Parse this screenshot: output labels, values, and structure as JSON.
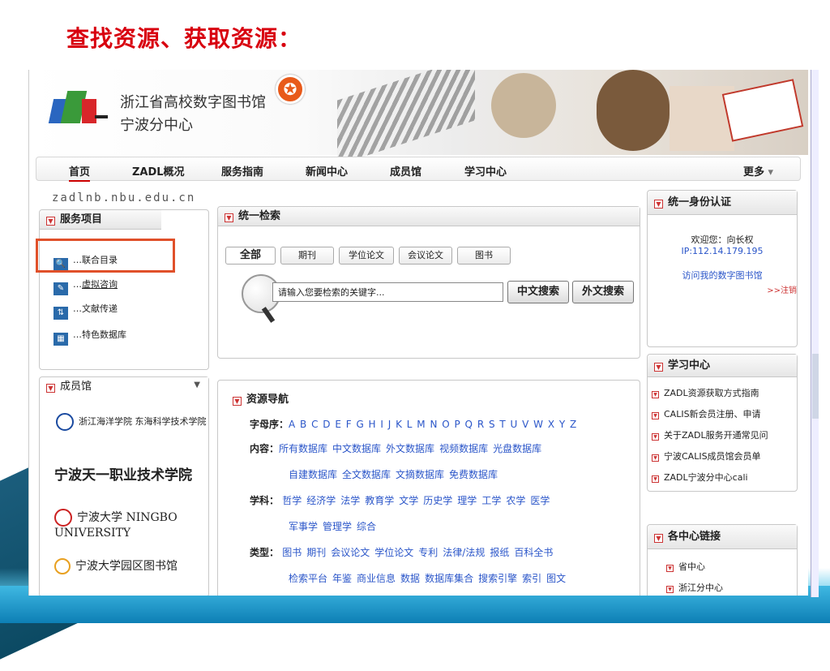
{
  "slide": {
    "title": "查找资源、获取资源："
  },
  "header": {
    "site_name": "浙江省高校数字图书馆",
    "site_sub": "宁波分中心",
    "domain": "zadlnb.nbu.edu.cn"
  },
  "nav": {
    "items": [
      "首页",
      "ZADL概况",
      "服务指南",
      "新闻中心",
      "成员馆",
      "学习中心"
    ],
    "more": "更多"
  },
  "services": {
    "title": "服务项目",
    "items": [
      "联合目录",
      "虚拟咨询",
      "文献传递",
      "特色数据库"
    ]
  },
  "members": {
    "title": "成员馆",
    "items": [
      "浙江海洋学院 东海科学技术学院",
      "宁波天一职业技术学院",
      "宁波大学 NINGBO UNIVERSITY",
      "宁波大学园区图书馆"
    ]
  },
  "search": {
    "title": "统一检索",
    "tabs": [
      "全部",
      "期刊",
      "学位论文",
      "会议论文",
      "图书"
    ],
    "placeholder": "请输入您要检索的关键字...",
    "btn_cn": "中文搜索",
    "btn_en": "外文搜索"
  },
  "resources": {
    "title": "资源导航",
    "alpha_label": "字母序：",
    "alpha": "A B C D E F G H I J K L M N O P Q R S T U V W X Y Z",
    "content_label": "内容：",
    "content1": [
      "所有数据库",
      "中文数据库",
      "外文数据库",
      "视频数据库",
      "光盘数据库"
    ],
    "content2": [
      "自建数据库",
      "全文数据库",
      "文摘数据库",
      "免费数据库"
    ],
    "subject_label": "学科：",
    "subject1": [
      "哲学",
      "经济学",
      "法学",
      "教育学",
      "文学",
      "历史学",
      "理学",
      "工学",
      "农学",
      "医学"
    ],
    "subject2": [
      "军事学",
      "管理学",
      "综合"
    ],
    "type_label": "类型：",
    "type1": [
      "图书",
      "期刊",
      "会议论文",
      "学位论文",
      "专利",
      "法律/法规",
      "报纸",
      "百科全书"
    ],
    "type2": [
      "检索平台",
      "年鉴",
      "商业信息",
      "数据",
      "数据库集合",
      "搜索引擎",
      "索引",
      "图文"
    ]
  },
  "auth": {
    "title": "统一身份认证",
    "welcome": "欢迎您：向长权",
    "ip": "IP:112.14.179.195",
    "visit": "访问我的数字图书馆",
    "logout": ">>注销"
  },
  "learn": {
    "title": "学习中心",
    "items": [
      "ZADL资源获取方式指南",
      "CALIS新会员注册、申请",
      "关于ZADL服务开通常见问",
      "宁波CALIS成员馆会员单",
      "ZADL宁波分中心cali"
    ]
  },
  "centers": {
    "title": "各中心链接",
    "items": [
      "省中心",
      "浙江分中心"
    ]
  }
}
